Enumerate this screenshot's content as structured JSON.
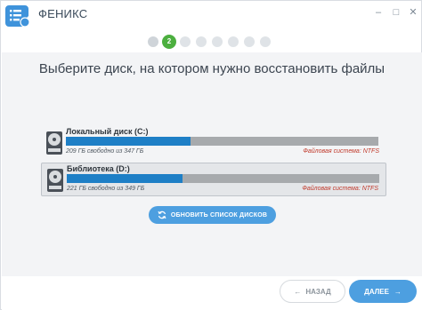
{
  "app": {
    "title": "ФЕНИКС",
    "logo_icon": "list-gear-icon",
    "accent": "#3f93db"
  },
  "window_controls": {
    "minimize": "–",
    "maximize": "□",
    "close": "✕"
  },
  "steps": {
    "total": 8,
    "current": 2,
    "current_label": "2",
    "active_color": "#4caf3f"
  },
  "main": {
    "heading": "Выберите диск, на котором нужно восстановить файлы",
    "disks": [
      {
        "name": "Локальный диск (C:)",
        "free_text": "209 ГБ свободно из 347 ГБ",
        "filesystem": "Файловая система: NTFS",
        "used_fraction": 0.4,
        "selected": false
      },
      {
        "name": "Библиотека (D:)",
        "free_text": "221 ГБ свободно из 349 ГБ",
        "filesystem": "Файловая система: NTFS",
        "used_fraction": 0.37,
        "selected": true
      }
    ],
    "refresh_label": "ОБНОВИТЬ СПИСОК ДИСКОВ"
  },
  "footer": {
    "back_label": "НАЗАД",
    "back_arrow": "←",
    "next_label": "ДАЛЕЕ",
    "next_arrow": "→"
  }
}
